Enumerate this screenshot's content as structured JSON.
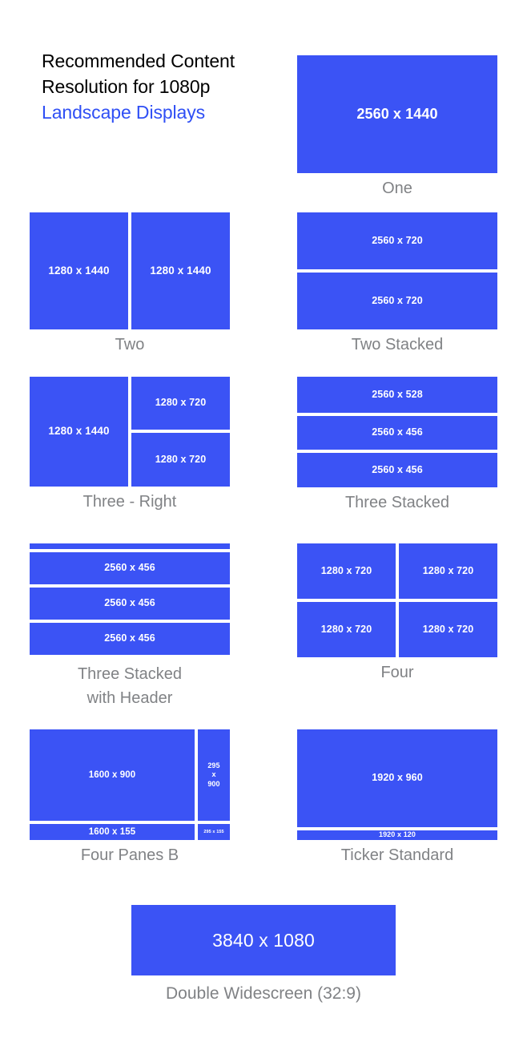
{
  "heading": {
    "line1": "Recommended Content",
    "line2": "Resolution for 1080p",
    "line3": "Landscape Displays",
    "accent_color": "#2f4ff5",
    "text_color": "#000000"
  },
  "theme": {
    "pane_color": "#3b53f5",
    "pane_text_color": "#ffffff",
    "caption_color": "#808285",
    "background": "#ffffff"
  },
  "layouts": [
    {
      "id": "one",
      "caption": "One",
      "panes": [
        {
          "label": "2560 x 1440"
        }
      ]
    },
    {
      "id": "two",
      "caption": "Two",
      "panes": [
        {
          "label": "1280 x 1440"
        },
        {
          "label": "1280 x 1440"
        }
      ]
    },
    {
      "id": "two-stacked",
      "caption": "Two Stacked",
      "panes": [
        {
          "label": "2560 x 720"
        },
        {
          "label": "2560 x 720"
        }
      ]
    },
    {
      "id": "three-right",
      "caption": "Three - Right",
      "panes": [
        {
          "label": "1280 x 1440"
        },
        {
          "label": "1280 x 720"
        },
        {
          "label": "1280 x 720"
        }
      ]
    },
    {
      "id": "three-stacked",
      "caption": "Three Stacked",
      "panes": [
        {
          "label": "2560 x 528"
        },
        {
          "label": "2560 x 456"
        },
        {
          "label": "2560 x 456"
        }
      ]
    },
    {
      "id": "three-stacked-header",
      "caption_line1": "Three Stacked",
      "caption_line2": "with Header",
      "panes": [
        {
          "label": ""
        },
        {
          "label": "2560 x 456"
        },
        {
          "label": "2560 x 456"
        },
        {
          "label": "2560 x 456"
        }
      ]
    },
    {
      "id": "four",
      "caption": "Four",
      "panes": [
        {
          "label": "1280 x 720"
        },
        {
          "label": "1280 x 720"
        },
        {
          "label": "1280 x 720"
        },
        {
          "label": "1280 x 720"
        }
      ]
    },
    {
      "id": "four-panes-b",
      "caption": "Four Panes B",
      "panes": [
        {
          "label": "1600 x 900"
        },
        {
          "label_line1": "295",
          "label_line2": "x",
          "label_line3": "900"
        },
        {
          "label": "1600 x 155"
        },
        {
          "label": "295 x 155"
        }
      ]
    },
    {
      "id": "ticker-standard",
      "caption": "Ticker Standard",
      "panes": [
        {
          "label": "1920 x 960"
        },
        {
          "label": "1920 x 120"
        }
      ]
    },
    {
      "id": "double-widescreen",
      "caption": "Double Widescreen (32:9)",
      "panes": [
        {
          "label": "3840 x 1080"
        }
      ]
    }
  ]
}
